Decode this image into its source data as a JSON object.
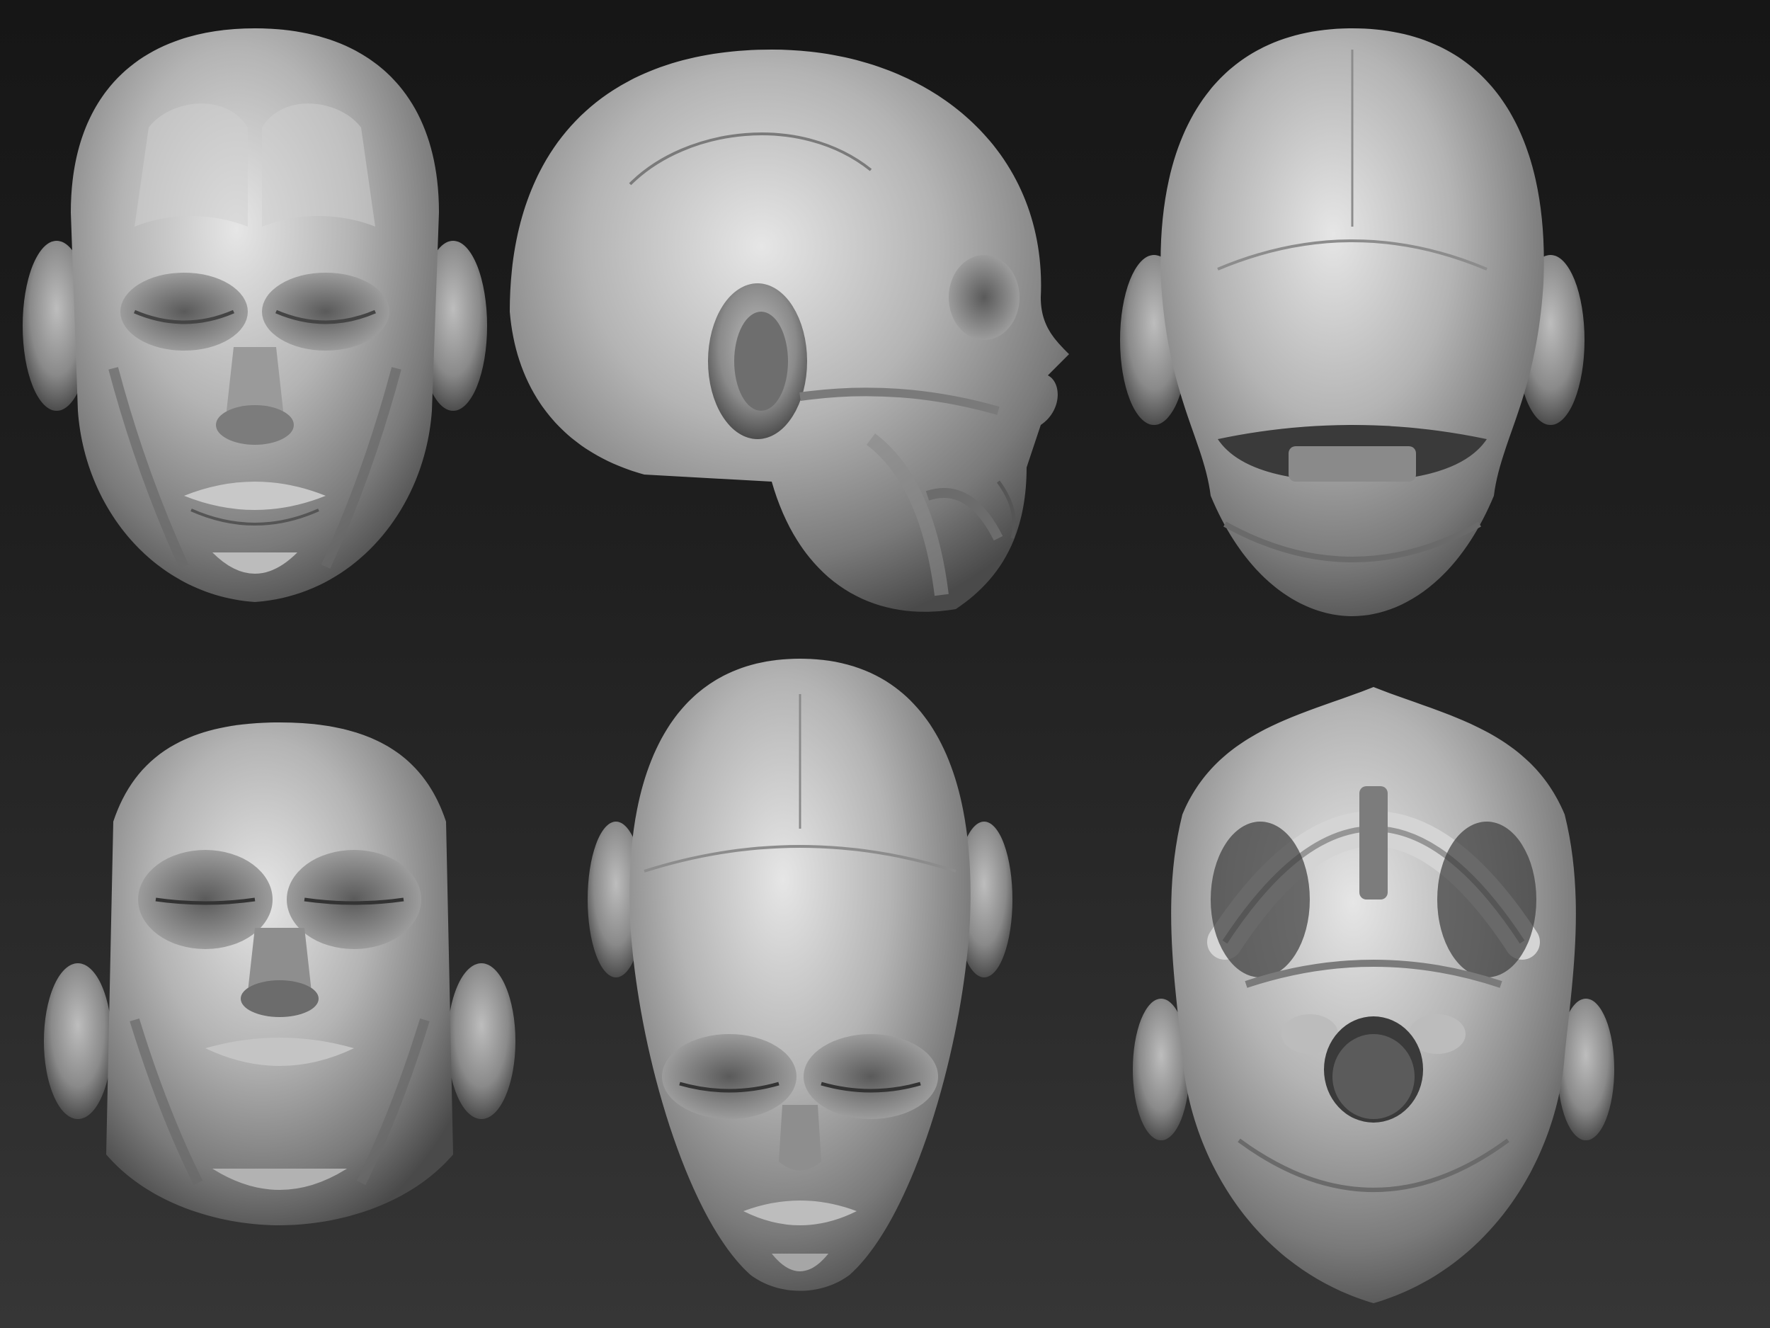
{
  "scene": {
    "background_top": "#161616",
    "background_bottom": "#363636",
    "clay_light": "#d8d8d8",
    "clay_mid": "#9a9a9a",
    "clay_dark": "#4a4a4a"
  },
  "views": [
    {
      "name": "front-muscles",
      "icon": "anatomy-head-front"
    },
    {
      "name": "side-muscles",
      "icon": "anatomy-head-profile"
    },
    {
      "name": "back",
      "icon": "anatomy-head-back"
    },
    {
      "name": "front-low-angle",
      "icon": "anatomy-head-front-low"
    },
    {
      "name": "top-down-front",
      "icon": "anatomy-head-top-front"
    },
    {
      "name": "bottom-skull-base",
      "icon": "anatomy-head-underside"
    }
  ]
}
